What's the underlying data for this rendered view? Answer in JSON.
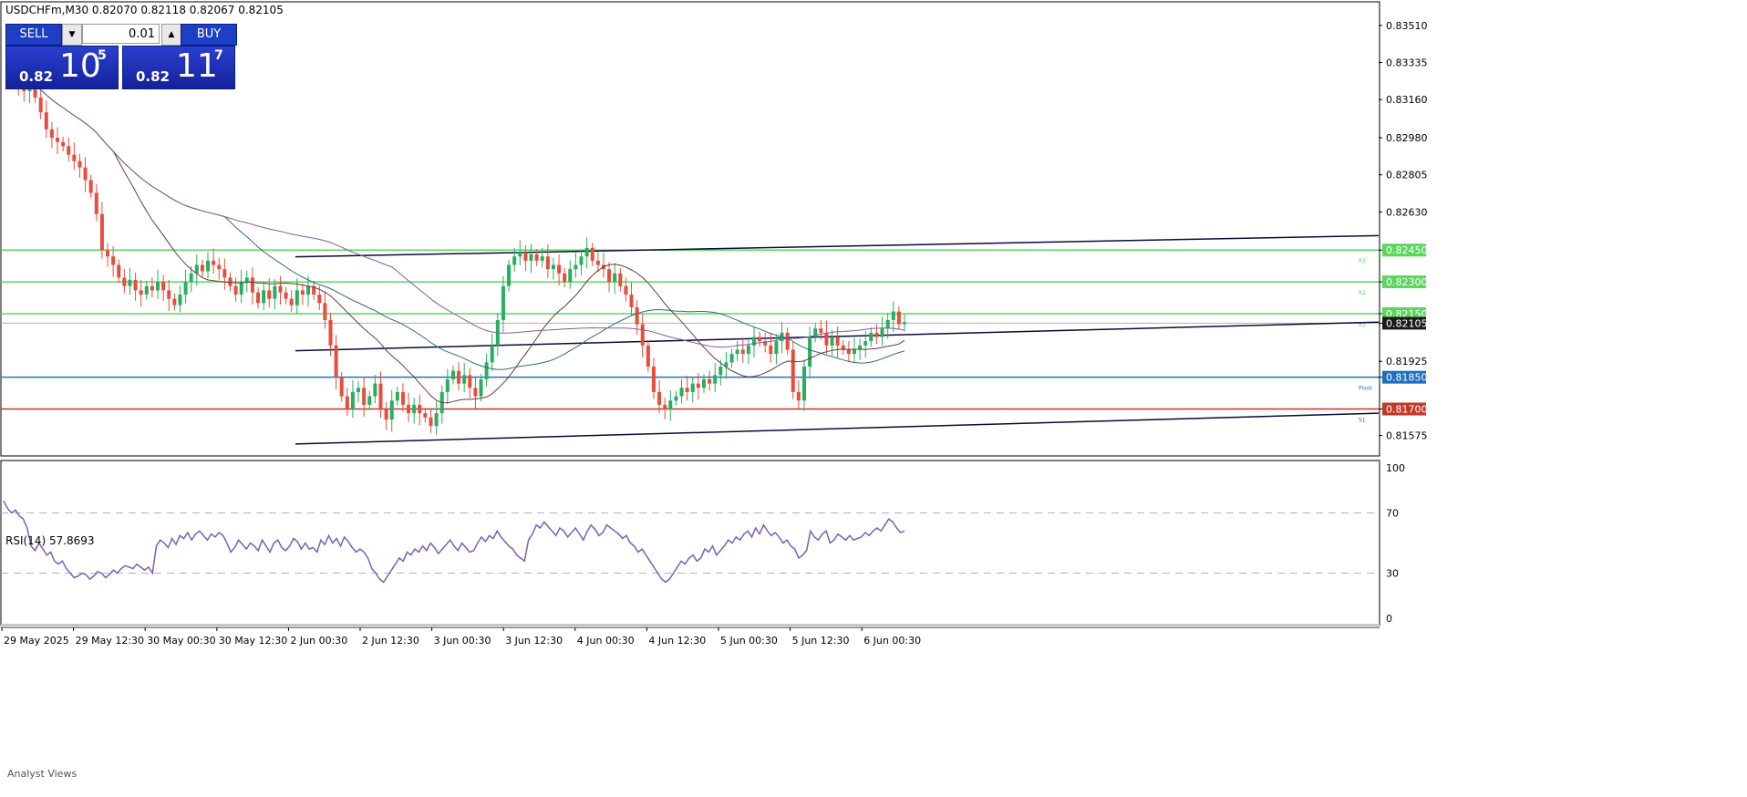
{
  "header": {
    "symbol_line": "USDCHFm,M30  0.82070 0.82118 0.82067 0.82105"
  },
  "trade_panel": {
    "sell_label": "SELL",
    "buy_label": "BUY",
    "lot_value": "0.01",
    "sell_price_small": "0.82",
    "sell_price_big": "10",
    "sell_price_sup": "5",
    "buy_price_small": "0.82",
    "buy_price_big": "11",
    "buy_price_sup": "7"
  },
  "rsi_panel": {
    "label": "RSI(14) 57.8693"
  },
  "footer": {
    "tab_label": "Analyst Views"
  },
  "colors": {
    "bull": "#27ae60",
    "bear": "#e74c3c",
    "support_resistance": "#5cd65c",
    "pivot": "#1f6fbf",
    "s_level": "#c0392b",
    "channel": "#0a0a3a",
    "rsi": "#7b5fb8",
    "price_tag": "#2ecc71"
  },
  "chart_data": [
    {
      "type": "candlestick",
      "symbol": "USDCHFm",
      "timeframe": "M30",
      "ylim": [
        0.815,
        0.836
      ],
      "y_ticks": [
        "0.83510",
        "0.83335",
        "0.83160",
        "0.82980",
        "0.82805",
        "0.82630",
        "0.82450",
        "0.82300",
        "0.82150",
        "0.82105",
        "0.81925",
        "0.81850",
        "0.81700",
        "0.81575"
      ],
      "x_ticks": [
        "29 May 2025",
        "29 May 12:30",
        "30 May 00:30",
        "30 May 12:30",
        "2 Jun 00:30",
        "2 Jun 12:30",
        "3 Jun 00:30",
        "3 Jun 12:30",
        "4 Jun 00:30",
        "4 Jun 12:30",
        "5 Jun 00:30",
        "5 Jun 12:30",
        "6 Jun 00:30"
      ],
      "close_path": [
        0.8327,
        0.8326,
        0.8322,
        0.832,
        0.8322,
        0.8317,
        0.831,
        0.8302,
        0.8298,
        0.8296,
        0.8294,
        0.829,
        0.8287,
        0.8284,
        0.8278,
        0.8272,
        0.8262,
        0.8245,
        0.8242,
        0.8238,
        0.8232,
        0.8228,
        0.8231,
        0.8226,
        0.8224,
        0.8228,
        0.8226,
        0.823,
        0.8226,
        0.8222,
        0.8219,
        0.8224,
        0.823,
        0.8234,
        0.8238,
        0.8235,
        0.824,
        0.8238,
        0.8236,
        0.8232,
        0.8228,
        0.8224,
        0.823,
        0.8232,
        0.8225,
        0.822,
        0.8226,
        0.8222,
        0.8228,
        0.8225,
        0.8222,
        0.8219,
        0.8226,
        0.8224,
        0.8228,
        0.8224,
        0.822,
        0.8212,
        0.82,
        0.8185,
        0.8176,
        0.817,
        0.8178,
        0.818,
        0.8172,
        0.8176,
        0.8182,
        0.817,
        0.8165,
        0.8174,
        0.8178,
        0.8172,
        0.8168,
        0.8172,
        0.8168,
        0.8166,
        0.8162,
        0.8168,
        0.8178,
        0.8184,
        0.8188,
        0.8182,
        0.8186,
        0.818,
        0.8176,
        0.8184,
        0.8192,
        0.82,
        0.8212,
        0.8228,
        0.8238,
        0.8242,
        0.8244,
        0.824,
        0.8243,
        0.824,
        0.8242,
        0.8236,
        0.8238,
        0.8234,
        0.823,
        0.8236,
        0.8238,
        0.8242,
        0.8246,
        0.824,
        0.8238,
        0.8236,
        0.823,
        0.8234,
        0.8228,
        0.8224,
        0.8218,
        0.821,
        0.82,
        0.819,
        0.8178,
        0.8172,
        0.817,
        0.8174,
        0.8176,
        0.818,
        0.8178,
        0.8182,
        0.818,
        0.8184,
        0.8182,
        0.8186,
        0.819,
        0.8192,
        0.8196,
        0.8198,
        0.8196,
        0.82,
        0.8204,
        0.8202,
        0.82,
        0.8196,
        0.8202,
        0.8206,
        0.8198,
        0.8178,
        0.8174,
        0.819,
        0.8204,
        0.8208,
        0.8206,
        0.82,
        0.8204,
        0.82,
        0.8198,
        0.8196,
        0.8198,
        0.82,
        0.8202,
        0.8206,
        0.8204,
        0.8208,
        0.8212,
        0.8216,
        0.821,
        0.8211
      ],
      "horizontal_levels": [
        {
          "price": 0.8245,
          "label": "R3",
          "kind": "resistance"
        },
        {
          "price": 0.823,
          "label": "R2",
          "kind": "resistance"
        },
        {
          "price": 0.8215,
          "label": "R1",
          "kind": "resistance"
        },
        {
          "price": 0.8185,
          "label": "Pivot",
          "kind": "pivot"
        },
        {
          "price": 0.817,
          "label": "S1",
          "kind": "support"
        }
      ],
      "current_price": 0.82105
    },
    {
      "type": "line",
      "name": "RSI(14)",
      "value": 57.8693,
      "ylim": [
        0,
        100
      ],
      "y_ticks": [
        "100",
        "70",
        "30",
        "0"
      ],
      "levels": [
        70,
        30
      ],
      "values": [
        78,
        73,
        70,
        72,
        68,
        66,
        60,
        48,
        45,
        50,
        46,
        42,
        44,
        38,
        36,
        38,
        33,
        30,
        27,
        28,
        30,
        29,
        26,
        28,
        31,
        30,
        27,
        29,
        32,
        30,
        33,
        35,
        34,
        33,
        36,
        34,
        32,
        34,
        30,
        48,
        52,
        50,
        47,
        53,
        49,
        55,
        53,
        57,
        52,
        56,
        58,
        55,
        52,
        56,
        54,
        57,
        55,
        50,
        44,
        47,
        52,
        49,
        46,
        50,
        48,
        45,
        52,
        48,
        44,
        50,
        52,
        47,
        45,
        48,
        53,
        51,
        46,
        50,
        46,
        47,
        44,
        52,
        49,
        55,
        50,
        53,
        48,
        54,
        51,
        47,
        44,
        46,
        44,
        40,
        33,
        30,
        26,
        24,
        28,
        32,
        36,
        40,
        38,
        44,
        42,
        46,
        44,
        48,
        45,
        50,
        47,
        43,
        46,
        49,
        52,
        48,
        45,
        50,
        47,
        44,
        45,
        50,
        54,
        51,
        55,
        53,
        58,
        54,
        51,
        48,
        46,
        42,
        40,
        38,
        52,
        56,
        62,
        60,
        64,
        61,
        58,
        55,
        60,
        58,
        54,
        57,
        60,
        56,
        52,
        58,
        62,
        59,
        55,
        57,
        62,
        60,
        58,
        56,
        53,
        55,
        50,
        48,
        44,
        46,
        42,
        38,
        34,
        30,
        26,
        24,
        26,
        30,
        34,
        38,
        36,
        40,
        42,
        38,
        40,
        46,
        44,
        48,
        42,
        45,
        48,
        52,
        50,
        54,
        52,
        56,
        58,
        54,
        60,
        56,
        62,
        58,
        55,
        57,
        54,
        50,
        52,
        48,
        46,
        40,
        42,
        45,
        58,
        54,
        52,
        56,
        58,
        50,
        52,
        56,
        54,
        52,
        55,
        52,
        53,
        54,
        57,
        55,
        58,
        60,
        58,
        62,
        66,
        64,
        60,
        57,
        58
      ]
    }
  ]
}
